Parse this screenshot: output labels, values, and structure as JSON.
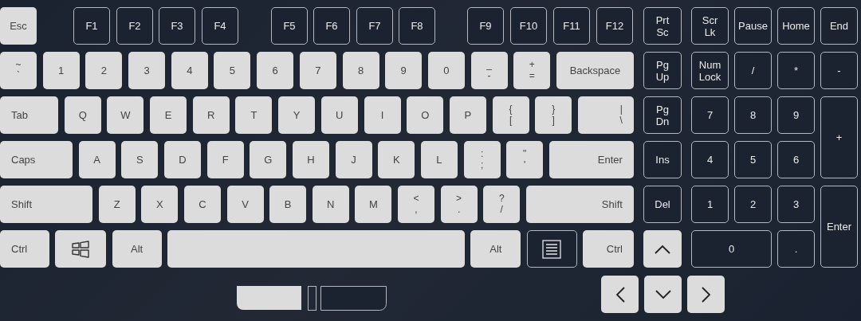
{
  "keyboard": {
    "rows": [
      {
        "keys": [
          {
            "label": "Esc",
            "kind": "light"
          },
          {
            "label": "F1",
            "kind": "dark"
          },
          {
            "label": "F2",
            "kind": "dark"
          },
          {
            "label": "F3",
            "kind": "dark"
          },
          {
            "label": "F4",
            "kind": "dark"
          },
          {
            "label": "F5",
            "kind": "dark"
          },
          {
            "label": "F6",
            "kind": "dark"
          },
          {
            "label": "F7",
            "kind": "dark"
          },
          {
            "label": "F8",
            "kind": "dark"
          },
          {
            "label": "F9",
            "kind": "dark"
          },
          {
            "label": "F10",
            "kind": "dark"
          },
          {
            "label": "F11",
            "kind": "dark"
          },
          {
            "label": "F12",
            "kind": "dark"
          }
        ]
      },
      {
        "keys": [
          {
            "shift_label": "~",
            "label": "`",
            "kind": "light"
          },
          {
            "label": "1",
            "kind": "light"
          },
          {
            "label": "2",
            "kind": "light"
          },
          {
            "label": "3",
            "kind": "light"
          },
          {
            "label": "4",
            "kind": "light"
          },
          {
            "label": "5",
            "kind": "light"
          },
          {
            "label": "6",
            "kind": "light"
          },
          {
            "label": "7",
            "kind": "light"
          },
          {
            "label": "8",
            "kind": "light"
          },
          {
            "label": "9",
            "kind": "light"
          },
          {
            "label": "0",
            "kind": "light"
          },
          {
            "shift_label": "_",
            "label": "-",
            "kind": "light"
          },
          {
            "shift_label": "+",
            "label": "=",
            "kind": "light"
          },
          {
            "label": "Backspace",
            "kind": "light"
          }
        ]
      },
      {
        "keys": [
          {
            "label": "Tab",
            "kind": "light"
          },
          {
            "label": "Q",
            "kind": "light"
          },
          {
            "label": "W",
            "kind": "light"
          },
          {
            "label": "E",
            "kind": "light"
          },
          {
            "label": "R",
            "kind": "light"
          },
          {
            "label": "T",
            "kind": "light"
          },
          {
            "label": "Y",
            "kind": "light"
          },
          {
            "label": "U",
            "kind": "light"
          },
          {
            "label": "I",
            "kind": "light"
          },
          {
            "label": "O",
            "kind": "light"
          },
          {
            "label": "P",
            "kind": "light"
          },
          {
            "shift_label": "{",
            "label": "[",
            "kind": "light"
          },
          {
            "shift_label": "}",
            "label": "]",
            "kind": "light"
          },
          {
            "shift_label": "|",
            "label": "\\",
            "kind": "light"
          }
        ]
      },
      {
        "keys": [
          {
            "label": "Caps",
            "kind": "light"
          },
          {
            "label": "A",
            "kind": "light"
          },
          {
            "label": "S",
            "kind": "light"
          },
          {
            "label": "D",
            "kind": "light"
          },
          {
            "label": "F",
            "kind": "light"
          },
          {
            "label": "G",
            "kind": "light"
          },
          {
            "label": "H",
            "kind": "light"
          },
          {
            "label": "J",
            "kind": "light"
          },
          {
            "label": "K",
            "kind": "light"
          },
          {
            "label": "L",
            "kind": "light"
          },
          {
            "shift_label": ":",
            "label": ";",
            "kind": "light"
          },
          {
            "shift_label": "\"",
            "label": "'",
            "kind": "light"
          },
          {
            "label": "Enter",
            "kind": "light"
          }
        ]
      },
      {
        "keys": [
          {
            "label": "Shift",
            "kind": "light"
          },
          {
            "label": "Z",
            "kind": "light"
          },
          {
            "label": "X",
            "kind": "light"
          },
          {
            "label": "C",
            "kind": "light"
          },
          {
            "label": "V",
            "kind": "light"
          },
          {
            "label": "B",
            "kind": "light"
          },
          {
            "label": "N",
            "kind": "light"
          },
          {
            "label": "M",
            "kind": "light"
          },
          {
            "shift_label": "<",
            "label": ",",
            "kind": "light"
          },
          {
            "shift_label": ">",
            "label": ".",
            "kind": "light"
          },
          {
            "shift_label": "?",
            "label": "/",
            "kind": "light"
          },
          {
            "label": "Shift",
            "kind": "light"
          }
        ]
      },
      {
        "keys": [
          {
            "label": "Ctrl",
            "kind": "light"
          },
          {
            "kind": "winkey"
          },
          {
            "label": "Alt",
            "kind": "light"
          },
          {
            "kind": "light"
          },
          {
            "label": "Alt",
            "kind": "light"
          },
          {
            "kind": "menukey"
          },
          {
            "label": "Ctrl",
            "kind": "light"
          }
        ]
      }
    ],
    "nav_keys": [
      {
        "label": "Prt\nSc",
        "kind": "dark"
      },
      {
        "label": "Pg\nUp",
        "kind": "dark"
      },
      {
        "label": "Pg\nDn",
        "kind": "dark"
      },
      {
        "label": "Ins",
        "kind": "dark"
      },
      {
        "label": "Del",
        "kind": "dark"
      },
      {
        "kind": "up"
      }
    ],
    "numpad": [
      {
        "label": "Scr\nLk",
        "kind": "dark"
      },
      {
        "label": "Pause",
        "kind": "dark"
      },
      {
        "label": "Home",
        "kind": "dark"
      },
      {
        "label": "End",
        "kind": "dark"
      },
      {
        "label": "Num\nLock",
        "kind": "dark"
      },
      {
        "label": "/",
        "kind": "dark"
      },
      {
        "label": "*",
        "kind": "dark"
      },
      {
        "label": "-",
        "kind": "dark"
      },
      {
        "label": "7",
        "kind": "dark"
      },
      {
        "label": "8",
        "kind": "dark"
      },
      {
        "label": "9",
        "kind": "dark"
      },
      {
        "label": "+",
        "kind": "dark"
      },
      {
        "label": "4",
        "kind": "dark"
      },
      {
        "label": "5",
        "kind": "dark"
      },
      {
        "label": "6",
        "kind": "dark"
      },
      {
        "label": "1",
        "kind": "dark"
      },
      {
        "label": "2",
        "kind": "dark"
      },
      {
        "label": "3",
        "kind": "dark"
      },
      {
        "label": "Enter",
        "kind": "dark"
      },
      {
        "label": "0",
        "kind": "dark"
      },
      {
        "label": ".",
        "kind": "dark"
      }
    ],
    "arrow_keys": [
      {
        "kind": "left"
      },
      {
        "kind": "down"
      },
      {
        "kind": "right"
      }
    ]
  }
}
